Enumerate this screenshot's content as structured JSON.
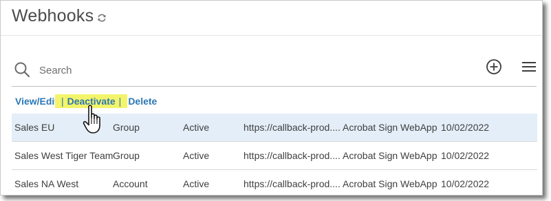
{
  "header": {
    "title": "Webhooks",
    "refresh_icon": "refresh-icon"
  },
  "search": {
    "placeholder": "Search",
    "value": ""
  },
  "toolbar": {
    "add_icon": "add-circle-icon",
    "menu_icon": "hamburger-menu-icon"
  },
  "actions": {
    "view_edit": "View/Edit",
    "deactivate": "Deactivate",
    "delete": "Delete",
    "separator": "|"
  },
  "rows": [
    {
      "name": "Sales EU",
      "scope": "Group",
      "status": "Active",
      "url": "https://callback-prod....",
      "app": "Acrobat Sign WebApp",
      "date": "10/02/2022",
      "selected": true
    },
    {
      "name": "Sales West Tiger Team",
      "scope": "Group",
      "status": "Active",
      "url": "https://callback-prod....",
      "app": "Acrobat Sign WebApp",
      "date": "10/02/2022",
      "selected": false
    },
    {
      "name": "Sales NA West",
      "scope": "Account",
      "status": "Active",
      "url": "https://callback-prod....",
      "app": "Acrobat Sign WebApp",
      "date": "10/02/2022",
      "selected": false
    }
  ],
  "colors": {
    "link": "#2b77b4",
    "highlight": "#f3f46a",
    "selected_row": "#e4eef8",
    "title": "#4b4b4b"
  }
}
